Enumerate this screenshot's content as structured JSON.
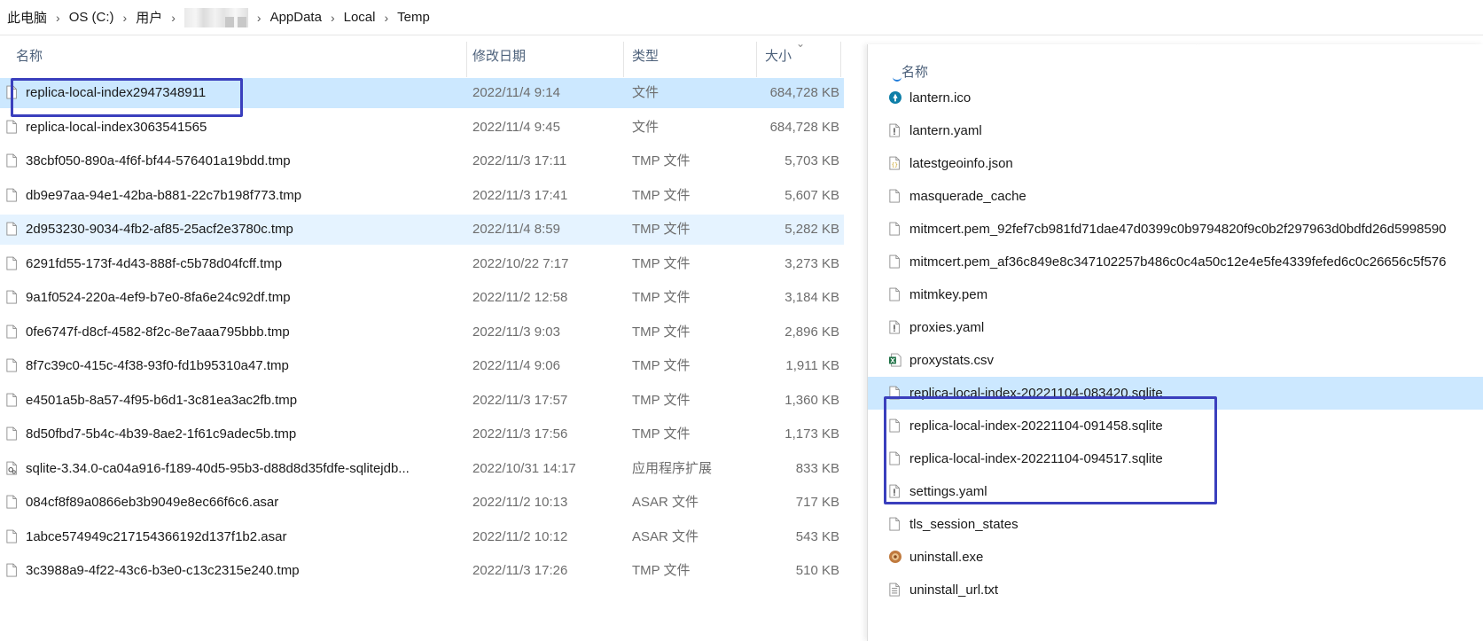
{
  "breadcrumb": [
    "此电脑",
    "OS (C:)",
    "用户",
    "AppData",
    "Local",
    "Temp"
  ],
  "left": {
    "columns": {
      "name": "名称",
      "date": "修改日期",
      "type": "类型",
      "size": "大小"
    },
    "rows": [
      {
        "name": "replica-local-index2947348911",
        "date": "2022/11/4 9:14",
        "type": "文件",
        "size": "684,728 KB",
        "icon": "file-icon",
        "state": "selected"
      },
      {
        "name": "replica-local-index3063541565",
        "date": "2022/11/4 9:45",
        "type": "文件",
        "size": "684,728 KB",
        "icon": "file-icon",
        "state": ""
      },
      {
        "name": "38cbf050-890a-4f6f-bf44-576401a19bdd.tmp",
        "date": "2022/11/3 17:11",
        "type": "TMP 文件",
        "size": "5,703 KB",
        "icon": "file-icon",
        "state": ""
      },
      {
        "name": "db9e97aa-94e1-42ba-b881-22c7b198f773.tmp",
        "date": "2022/11/3 17:41",
        "type": "TMP 文件",
        "size": "5,607 KB",
        "icon": "file-icon",
        "state": ""
      },
      {
        "name": "2d953230-9034-4fb2-af85-25acf2e3780c.tmp",
        "date": "2022/11/4 8:59",
        "type": "TMP 文件",
        "size": "5,282 KB",
        "icon": "file-icon",
        "state": "hover"
      },
      {
        "name": "6291fd55-173f-4d43-888f-c5b78d04fcff.tmp",
        "date": "2022/10/22 7:17",
        "type": "TMP 文件",
        "size": "3,273 KB",
        "icon": "file-icon",
        "state": ""
      },
      {
        "name": "9a1f0524-220a-4ef9-b7e0-8fa6e24c92df.tmp",
        "date": "2022/11/2 12:58",
        "type": "TMP 文件",
        "size": "3,184 KB",
        "icon": "file-icon",
        "state": ""
      },
      {
        "name": "0fe6747f-d8cf-4582-8f2c-8e7aaa795bbb.tmp",
        "date": "2022/11/3 9:03",
        "type": "TMP 文件",
        "size": "2,896 KB",
        "icon": "file-icon",
        "state": ""
      },
      {
        "name": "8f7c39c0-415c-4f38-93f0-fd1b95310a47.tmp",
        "date": "2022/11/4 9:06",
        "type": "TMP 文件",
        "size": "1,911 KB",
        "icon": "file-icon",
        "state": ""
      },
      {
        "name": "e4501a5b-8a57-4f95-b6d1-3c81ea3ac2fb.tmp",
        "date": "2022/11/3 17:57",
        "type": "TMP 文件",
        "size": "1,360 KB",
        "icon": "file-icon",
        "state": ""
      },
      {
        "name": "8d50fbd7-5b4c-4b39-8ae2-1f61c9adec5b.tmp",
        "date": "2022/11/3 17:56",
        "type": "TMP 文件",
        "size": "1,173 KB",
        "icon": "file-icon",
        "state": ""
      },
      {
        "name": "sqlite-3.34.0-ca04a916-f189-40d5-95b3-d88d8d35fdfe-sqlitejdb...",
        "date": "2022/10/31 14:17",
        "type": "应用程序扩展",
        "size": "833 KB",
        "icon": "dll-icon",
        "state": ""
      },
      {
        "name": "084cf8f89a0866eb3b9049e8ec66f6c6.asar",
        "date": "2022/11/2 10:13",
        "type": "ASAR 文件",
        "size": "717 KB",
        "icon": "file-icon",
        "state": ""
      },
      {
        "name": "1abce574949c217154366192d137f1b2.asar",
        "date": "2022/11/2 10:12",
        "type": "ASAR 文件",
        "size": "543 KB",
        "icon": "file-icon",
        "state": ""
      },
      {
        "name": "3c3988a9-4f22-43c6-b3e0-c13c2315e240.tmp",
        "date": "2022/11/3 17:26",
        "type": "TMP 文件",
        "size": "510 KB",
        "icon": "file-icon",
        "state": ""
      }
    ]
  },
  "right": {
    "column_name": "名称",
    "rows": [
      {
        "name": "lantern.ico",
        "icon": "lantern-app-icon",
        "state": ""
      },
      {
        "name": "lantern.yaml",
        "icon": "config-file-icon",
        "state": ""
      },
      {
        "name": "latestgeoinfo.json",
        "icon": "json-file-icon",
        "state": ""
      },
      {
        "name": "masquerade_cache",
        "icon": "file-icon",
        "state": ""
      },
      {
        "name": "mitmcert.pem_92fef7cb981fd71dae47d0399c0b9794820f9c0b2f297963d0bdfd26d5998590",
        "icon": "file-icon",
        "state": ""
      },
      {
        "name": "mitmcert.pem_af36c849e8c347102257b486c0c4a50c12e4e5fe4339fefed6c0c26656c5f576",
        "icon": "file-icon",
        "state": ""
      },
      {
        "name": "mitmkey.pem",
        "icon": "file-icon",
        "state": ""
      },
      {
        "name": "proxies.yaml",
        "icon": "config-file-icon",
        "state": ""
      },
      {
        "name": "proxystats.csv",
        "icon": "excel-csv-icon",
        "state": ""
      },
      {
        "name": "replica-local-index-20221104-083420.sqlite",
        "icon": "file-icon",
        "state": "selected"
      },
      {
        "name": "replica-local-index-20221104-091458.sqlite",
        "icon": "file-icon",
        "state": ""
      },
      {
        "name": "replica-local-index-20221104-094517.sqlite",
        "icon": "file-icon",
        "state": ""
      },
      {
        "name": "settings.yaml",
        "icon": "config-file-icon",
        "state": ""
      },
      {
        "name": "tls_session_states",
        "icon": "file-icon",
        "state": ""
      },
      {
        "name": "uninstall.exe",
        "icon": "installer-icon",
        "state": ""
      },
      {
        "name": "uninstall_url.txt",
        "icon": "text-file-icon",
        "state": ""
      }
    ]
  },
  "colors": {
    "selected": "#cce8ff",
    "hover": "#e5f3ff",
    "annotation": "#3a3fbd",
    "header_text": "#4c607a"
  }
}
